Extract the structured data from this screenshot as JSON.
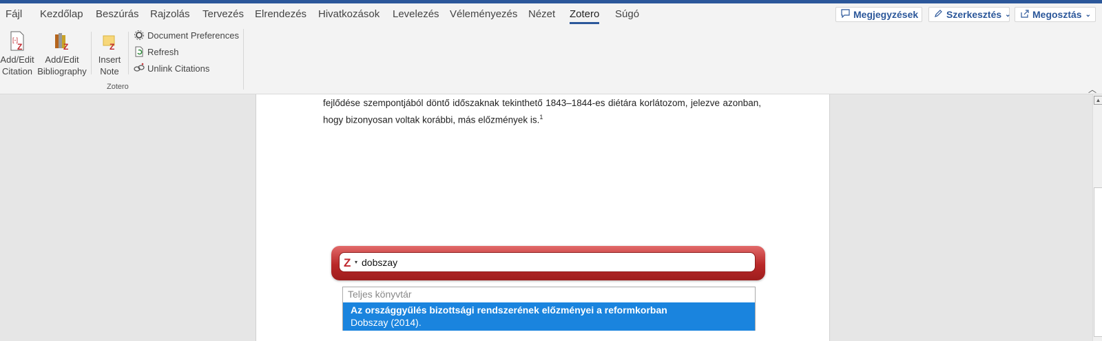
{
  "tabs": [
    "Fájl",
    "Kezdőlap",
    "Beszúrás",
    "Rajzolás",
    "Tervezés",
    "Elrendezés",
    "Hivatkozások",
    "Levelezés",
    "Véleményezés",
    "Nézet",
    "Zotero",
    "Súgó"
  ],
  "active_tab": "Zotero",
  "header_buttons": {
    "comments": "Megjegyzések",
    "editing": "Szerkesztés",
    "share": "Megosztás"
  },
  "ribbon": {
    "add_edit_citation": [
      "Add/Edit",
      "Citation"
    ],
    "add_edit_bibliography": [
      "Add/Edit",
      "Bibliography"
    ],
    "insert_note": [
      "Insert",
      "Note"
    ],
    "document_preferences": "Document Preferences",
    "refresh": "Refresh",
    "unlink_citations": "Unlink Citations",
    "group_label": "Zotero"
  },
  "document": {
    "paragraph": "fejlődése szempontjából döntő időszaknak tekinthető 1843–1844-es diétára korlátozom, jelezve azonban, hogy bizonyosan voltak korábbi, más előzmények is.",
    "footnote_ref": "1"
  },
  "zotero_search": {
    "query": "dobszay",
    "results_header": "Teljes könyvtár",
    "results": [
      {
        "title": "Az országgyűlés bizottsági rendszerének előzményei a reformkorban",
        "subtitle": "Dobszay (2014)."
      }
    ]
  },
  "colors": {
    "accent": "#2b579a",
    "zotero_red": "#b92828",
    "selection": "#1a84de"
  }
}
